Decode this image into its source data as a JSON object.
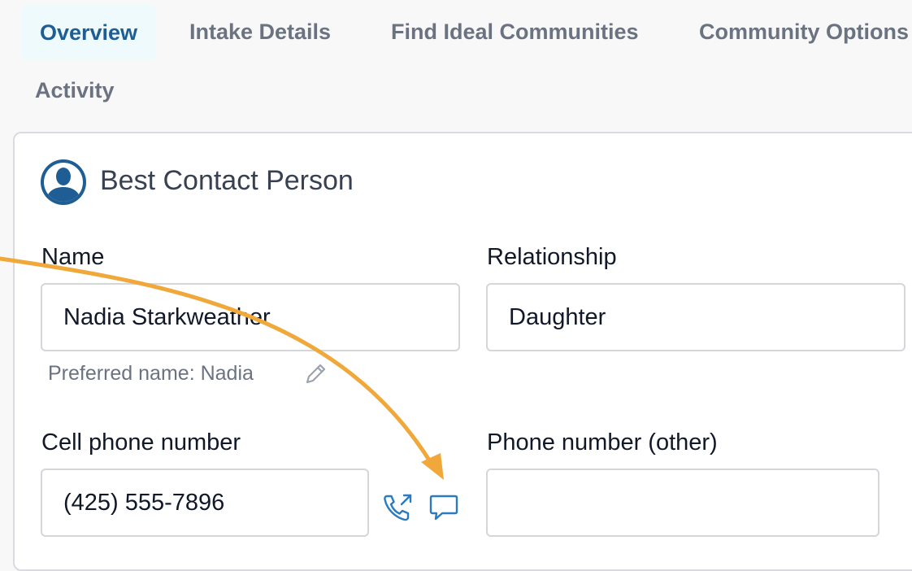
{
  "tabs": [
    {
      "label": "Overview",
      "active": true
    },
    {
      "label": "Intake Details",
      "active": false
    },
    {
      "label": "Find Ideal Communities",
      "active": false
    },
    {
      "label": "Community Options",
      "active": false
    },
    {
      "label": "Activity",
      "active": false
    }
  ],
  "card": {
    "title": "Best Contact Person",
    "icon": "person-circle-icon"
  },
  "fields": {
    "name": {
      "label": "Name",
      "value": "Nadia Starkweather"
    },
    "preferred_name": "Preferred name: Nadia",
    "relationship": {
      "label": "Relationship",
      "value": "Daughter"
    },
    "cell_phone": {
      "label": "Cell phone number",
      "value": "(425) 555-7896"
    },
    "other_phone": {
      "label": "Phone number (other)",
      "value": ""
    }
  },
  "icons": {
    "edit": "pencil-icon",
    "call": "phone-outgoing-icon",
    "message": "chat-bubble-icon"
  },
  "colors": {
    "active_tab_text": "#1f5e94",
    "active_tab_bg": "#eefafb",
    "icon_blue": "#2b7bbf",
    "annotation_arrow": "#f0a83a"
  }
}
